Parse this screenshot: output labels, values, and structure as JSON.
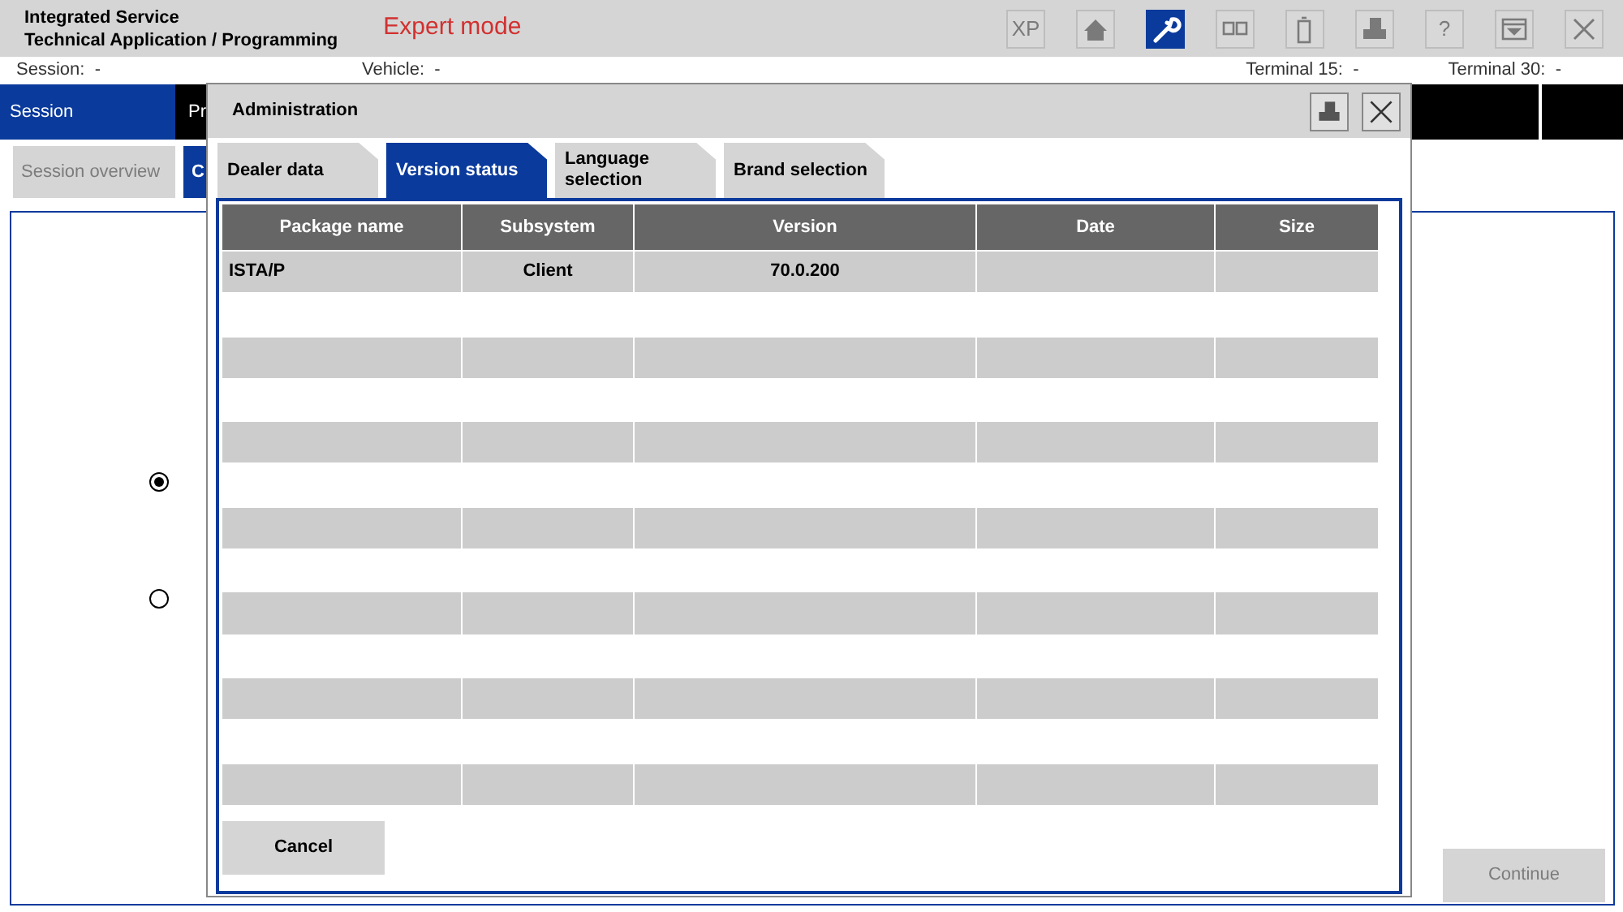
{
  "header": {
    "title_lines": [
      "Integrated Service",
      "Technical Application / Programming"
    ],
    "mode": "Expert mode"
  },
  "toolbar": [
    {
      "kind": "text",
      "label": "XP",
      "selected": false
    },
    {
      "kind": "home",
      "selected": false
    },
    {
      "kind": "wrench",
      "selected": true
    },
    {
      "kind": "screens",
      "selected": false
    },
    {
      "kind": "battery",
      "selected": false
    },
    {
      "kind": "printer",
      "selected": false
    },
    {
      "kind": "text",
      "label": "?",
      "selected": false
    },
    {
      "kind": "dropdown",
      "selected": false
    },
    {
      "kind": "close",
      "selected": false
    }
  ],
  "info_bar": [
    {
      "label": "Session:",
      "value": "-"
    },
    {
      "label": "Vehicle:",
      "value": "-"
    },
    {
      "label": "Terminal 15:",
      "value": "-"
    },
    {
      "label": "Terminal 30:",
      "value": "-"
    }
  ],
  "nav_tabs": [
    {
      "label": "Session",
      "selected": true
    },
    {
      "label": "Pr",
      "selected": false
    }
  ],
  "sub_tabs": [
    {
      "label": "Session overview",
      "selected": false,
      "disabled": true
    },
    {
      "label": "C",
      "selected": true,
      "disabled": false
    }
  ],
  "options": [
    {
      "selected": true
    },
    {
      "selected": false
    }
  ],
  "continue_button": {
    "label": "Continue",
    "disabled": true
  },
  "dialog": {
    "title": "Administration",
    "tabs": [
      {
        "label": "Dealer data",
        "selected": false
      },
      {
        "label": "Version status",
        "selected": true
      },
      {
        "label": "Language selection",
        "selected": false
      },
      {
        "label": "Brand selection",
        "selected": false
      }
    ],
    "table": {
      "columns": [
        "Package name",
        "Subsystem",
        "Version",
        "Date",
        "Size"
      ],
      "rows": [
        [
          "ISTA/P",
          "Client",
          "70.0.200"
        ]
      ]
    },
    "cancel_button": "Cancel"
  }
}
